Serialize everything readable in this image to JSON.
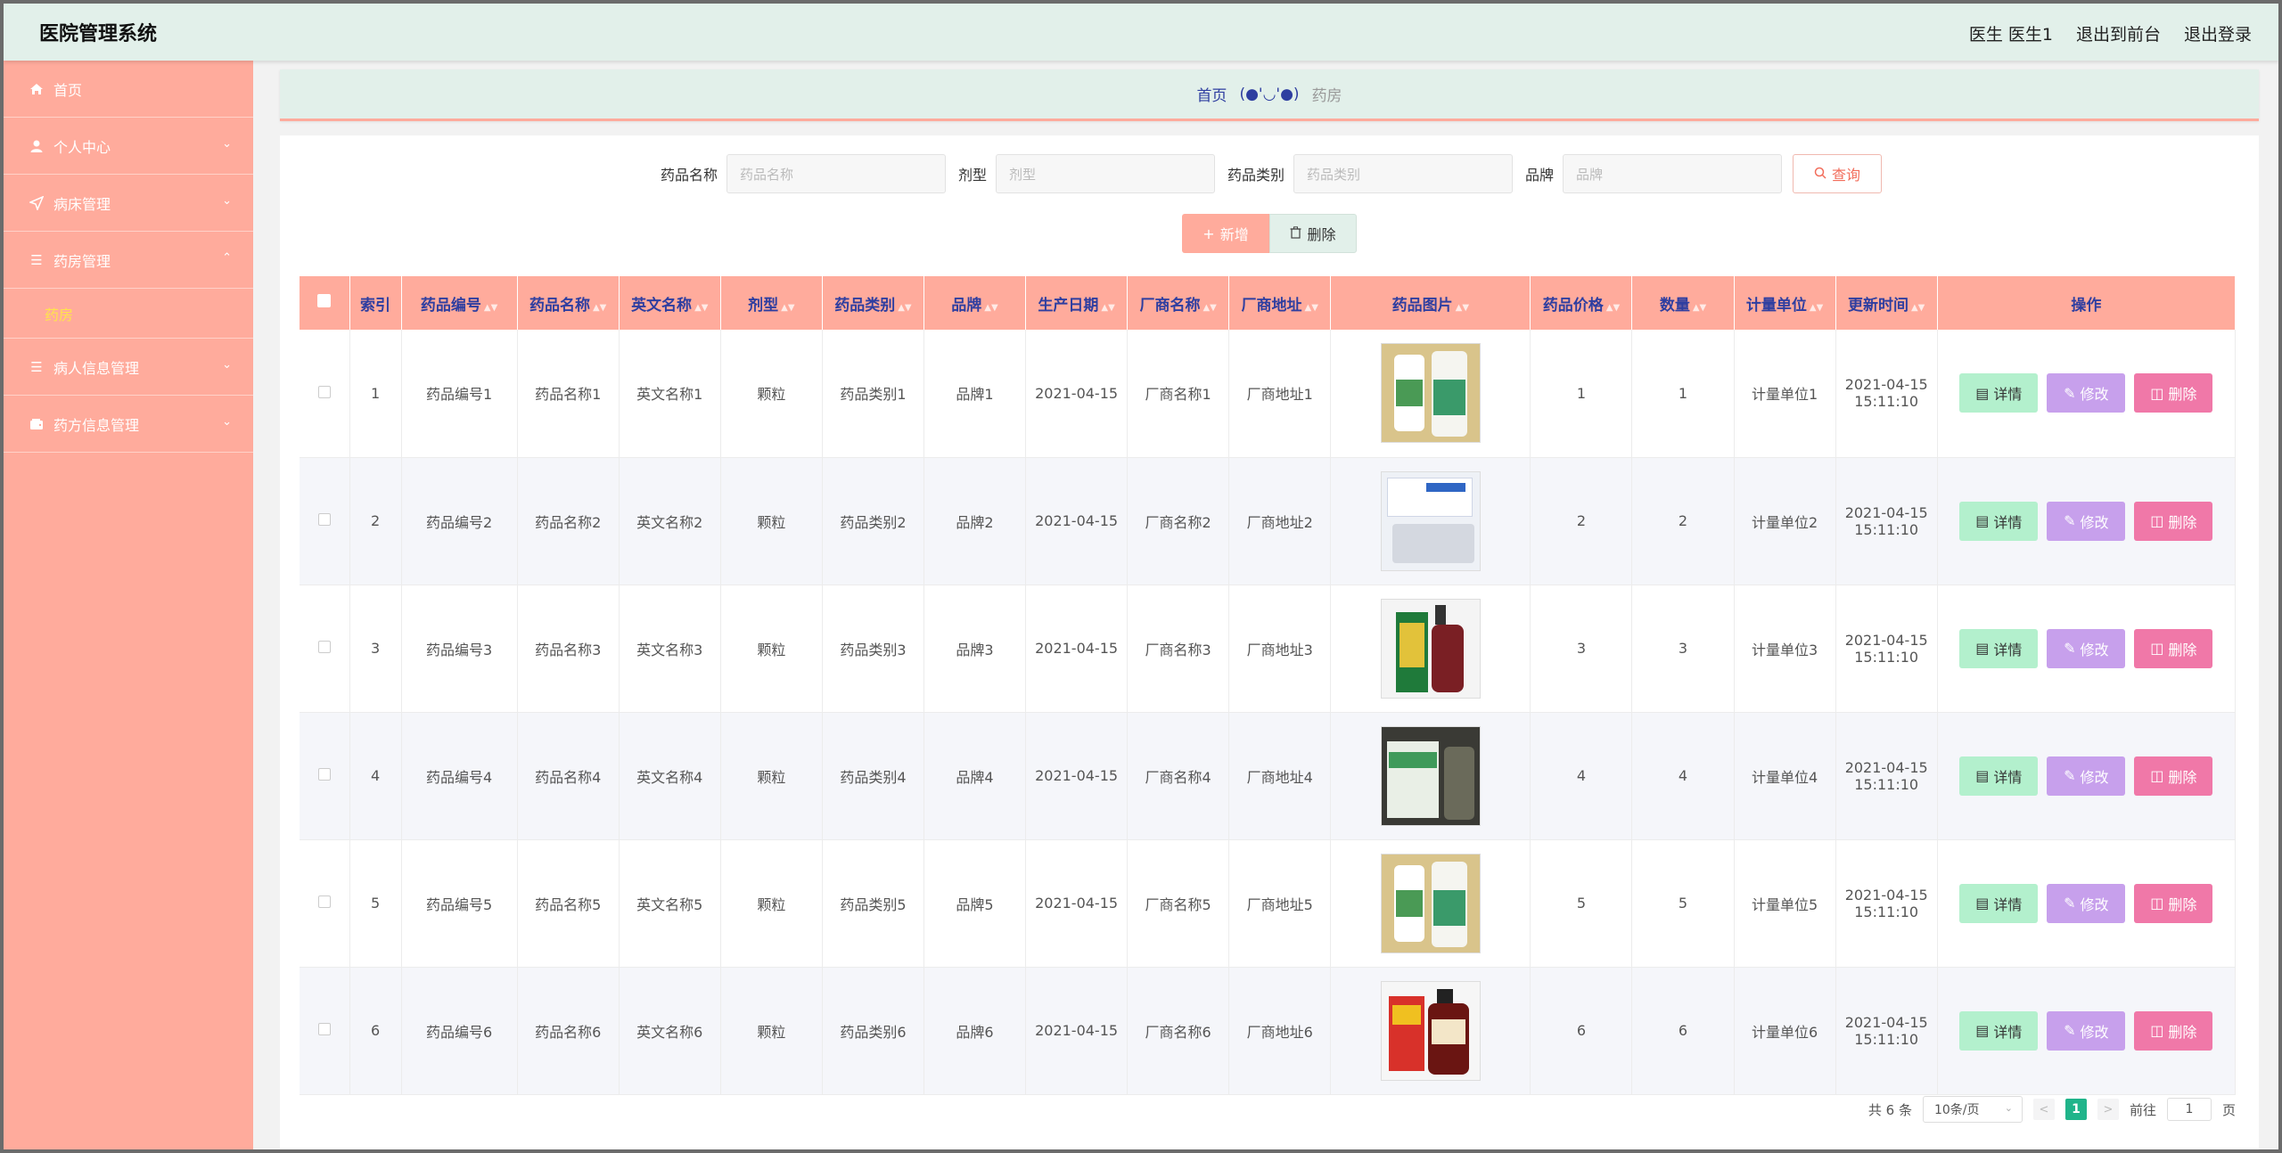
{
  "header": {
    "title": "医院管理系统",
    "user_label": "医生 医生1",
    "front_link": "退出到前台",
    "logout_link": "退出登录"
  },
  "sidebar": {
    "items": [
      {
        "label": "首页",
        "icon": "home-icon"
      },
      {
        "label": "个人中心",
        "icon": "user-icon"
      },
      {
        "label": "病床管理",
        "icon": "send-icon"
      },
      {
        "label": "药房管理",
        "icon": "menu-icon"
      },
      {
        "label": "病人信息管理",
        "icon": "menu-icon"
      },
      {
        "label": "药方信息管理",
        "icon": "wallet-icon"
      }
    ],
    "sub_active": "药房",
    "sub_active_color": "#ffe34d"
  },
  "breadcrumb": {
    "home": "首页",
    "separator": "(●'◡'●)",
    "current": "药房"
  },
  "search": {
    "fields": [
      {
        "label": "药品名称",
        "placeholder": "药品名称"
      },
      {
        "label": "剂型",
        "placeholder": "剂型"
      },
      {
        "label": "药品类别",
        "placeholder": "药品类别"
      },
      {
        "label": "品牌",
        "placeholder": "品牌"
      }
    ],
    "query_label": "查询"
  },
  "actions": {
    "add_label": "新增",
    "delete_label": "删除"
  },
  "table": {
    "columns": [
      "索引",
      "药品编号",
      "药品名称",
      "英文名称",
      "剂型",
      "药品类别",
      "品牌",
      "生产日期",
      "厂商名称",
      "厂商地址",
      "药品图片",
      "药品价格",
      "数量",
      "计量单位",
      "更新时间",
      "操作"
    ],
    "rows": [
      {
        "index": "1",
        "code": "药品编号1",
        "name": "药品名称1",
        "en": "英文名称1",
        "form": "颗粒",
        "category": "药品类别1",
        "brand": "品牌1",
        "date": "2021-04-15",
        "maker": "厂商名称1",
        "address": "厂商地址1",
        "price": "1",
        "qty": "1",
        "unit": "计量单位1",
        "updated_date": "2021-04-15",
        "updated_time": "15:11:10"
      },
      {
        "index": "2",
        "code": "药品编号2",
        "name": "药品名称2",
        "en": "英文名称2",
        "form": "颗粒",
        "category": "药品类别2",
        "brand": "品牌2",
        "date": "2021-04-15",
        "maker": "厂商名称2",
        "address": "厂商地址2",
        "price": "2",
        "qty": "2",
        "unit": "计量单位2",
        "updated_date": "2021-04-15",
        "updated_time": "15:11:10"
      },
      {
        "index": "3",
        "code": "药品编号3",
        "name": "药品名称3",
        "en": "英文名称3",
        "form": "颗粒",
        "category": "药品类别3",
        "brand": "品牌3",
        "date": "2021-04-15",
        "maker": "厂商名称3",
        "address": "厂商地址3",
        "price": "3",
        "qty": "3",
        "unit": "计量单位3",
        "updated_date": "2021-04-15",
        "updated_time": "15:11:10"
      },
      {
        "index": "4",
        "code": "药品编号4",
        "name": "药品名称4",
        "en": "英文名称4",
        "form": "颗粒",
        "category": "药品类别4",
        "brand": "品牌4",
        "date": "2021-04-15",
        "maker": "厂商名称4",
        "address": "厂商地址4",
        "price": "4",
        "qty": "4",
        "unit": "计量单位4",
        "updated_date": "2021-04-15",
        "updated_time": "15:11:10"
      },
      {
        "index": "5",
        "code": "药品编号5",
        "name": "药品名称5",
        "en": "英文名称5",
        "form": "颗粒",
        "category": "药品类别5",
        "brand": "品牌5",
        "date": "2021-04-15",
        "maker": "厂商名称5",
        "address": "厂商地址5",
        "price": "5",
        "qty": "5",
        "unit": "计量单位5",
        "updated_date": "2021-04-15",
        "updated_time": "15:11:10"
      },
      {
        "index": "6",
        "code": "药品编号6",
        "name": "药品名称6",
        "en": "英文名称6",
        "form": "颗粒",
        "category": "药品类别6",
        "brand": "品牌6",
        "date": "2021-04-15",
        "maker": "厂商名称6",
        "address": "厂商地址6",
        "price": "6",
        "qty": "6",
        "unit": "计量单位6",
        "updated_date": "2021-04-15",
        "updated_time": "15:11:10"
      }
    ],
    "row_actions": {
      "detail": "详情",
      "edit": "修改",
      "delete": "删除"
    }
  },
  "pagination": {
    "total": "共 6 条",
    "page_size": "10条/页",
    "current_page": "1",
    "goto_label": "前往",
    "goto_value": "1",
    "page_suffix": "页"
  },
  "colors": {
    "accent": "#ffab9c",
    "header_bg": "#e2f0ea",
    "column_text": "#2e3ea0",
    "detail_button": "#b3f0cd",
    "edit_button": "#c7a0ec",
    "delete_button": "#f078a8",
    "pager_active": "#20b48a"
  }
}
